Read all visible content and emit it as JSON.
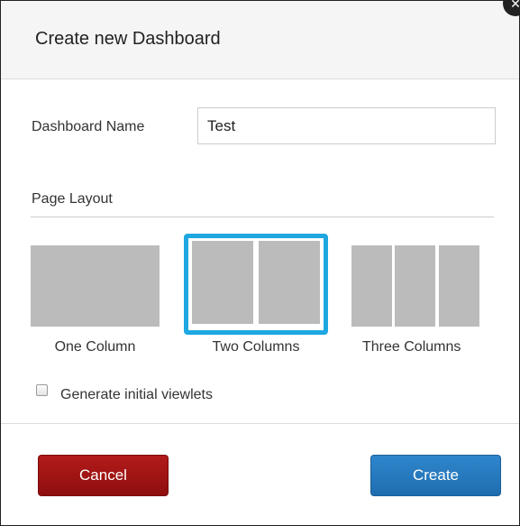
{
  "dialog": {
    "title": "Create new Dashboard",
    "close_icon": "close-icon"
  },
  "form": {
    "name_label": "Dashboard Name",
    "name_value": "Test",
    "layout_label": "Page Layout"
  },
  "layouts": [
    {
      "label": "One Column",
      "columns": 1,
      "selected": false
    },
    {
      "label": "Two Columns",
      "columns": 2,
      "selected": true
    },
    {
      "label": "Three Columns",
      "columns": 3,
      "selected": false
    }
  ],
  "options": {
    "generate_label": "Generate initial viewlets",
    "generate_checked": false
  },
  "buttons": {
    "cancel": "Cancel",
    "create": "Create"
  },
  "colors": {
    "selected_border": "#1ea7e1",
    "layout_block": "#bcbbbb",
    "cancel_bg": "#a01414",
    "create_bg": "#2778c0"
  }
}
